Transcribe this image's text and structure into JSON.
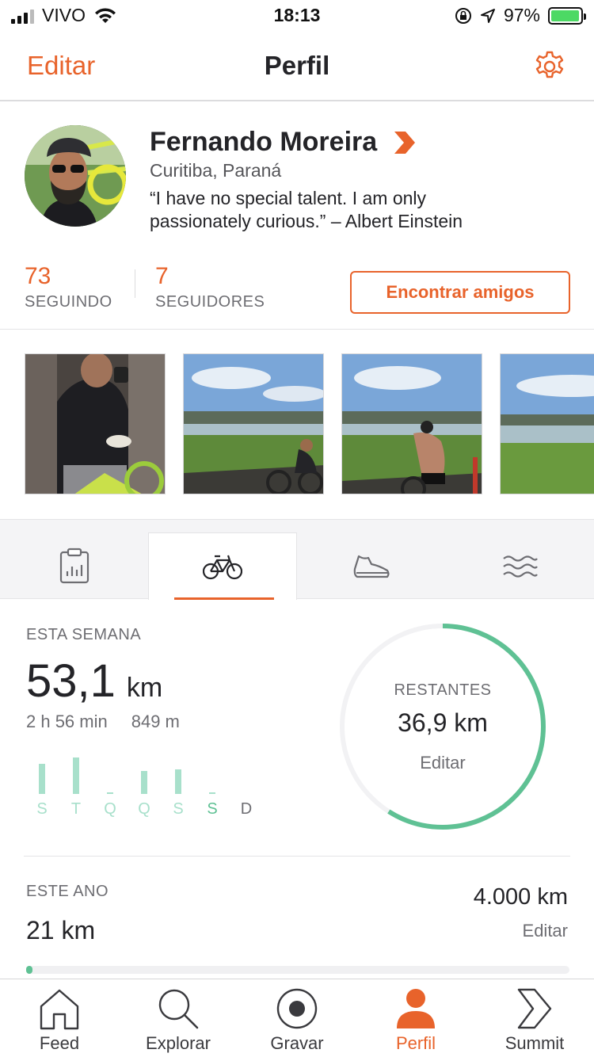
{
  "status_bar": {
    "carrier": "VIVO",
    "time": "18:13",
    "battery_percent": "97%",
    "signal_bars_on": 3,
    "battery_fill_fraction": 0.97
  },
  "nav": {
    "edit_label": "Editar",
    "title": "Perfil",
    "settings_icon": "gear-icon"
  },
  "profile": {
    "name": "Fernando Moreira",
    "location": "Curitiba, Paraná",
    "bio": "“I have no special talent. I am only passionately curious.” – Albert Einstein",
    "following_count": "73",
    "following_label": "SEGUINDO",
    "followers_count": "7",
    "followers_label": "SEGUIDORES",
    "find_friends_label": "Encontrar amigos"
  },
  "tabs": [
    {
      "icon": "clipboard-chart-icon",
      "active": false
    },
    {
      "icon": "bicycle-icon",
      "active": true
    },
    {
      "icon": "running-shoe-icon",
      "active": false
    },
    {
      "icon": "waves-icon",
      "active": false
    }
  ],
  "this_week": {
    "label": "ESTA SEMANA",
    "distance_value": "53,1",
    "distance_unit": "km",
    "time": "2 h 56 min",
    "elevation": "849 m",
    "days": [
      {
        "letter": "S",
        "level": 0.8
      },
      {
        "letter": "T",
        "level": 0.95
      },
      {
        "letter": "Q",
        "level": 0
      },
      {
        "letter": "Q",
        "level": 0.6
      },
      {
        "letter": "S",
        "level": 0.65
      },
      {
        "letter": "S",
        "level": 0
      },
      {
        "letter": "D",
        "level": null
      }
    ],
    "remaining_label": "RESTANTES",
    "remaining_value": "36,9 km",
    "remaining_edit": "Editar",
    "goal_progress_fraction": 0.59
  },
  "this_year": {
    "label": "ESTE ANO",
    "value": "21 km",
    "goal": "4.000 km",
    "edit": "Editar",
    "progress_fraction": 0.005
  },
  "tabbar": [
    {
      "label": "Feed",
      "icon": "home-icon",
      "active": false
    },
    {
      "label": "Explorar",
      "icon": "search-icon",
      "active": false
    },
    {
      "label": "Gravar",
      "icon": "record-icon",
      "active": false
    },
    {
      "label": "Perfil",
      "icon": "person-icon",
      "active": true
    },
    {
      "label": "Summit",
      "icon": "summit-chevron-icon",
      "active": false
    }
  ],
  "colors": {
    "accent": "#e8632b",
    "goal_green": "#5fc194",
    "bar_green": "#a8e0cb"
  }
}
